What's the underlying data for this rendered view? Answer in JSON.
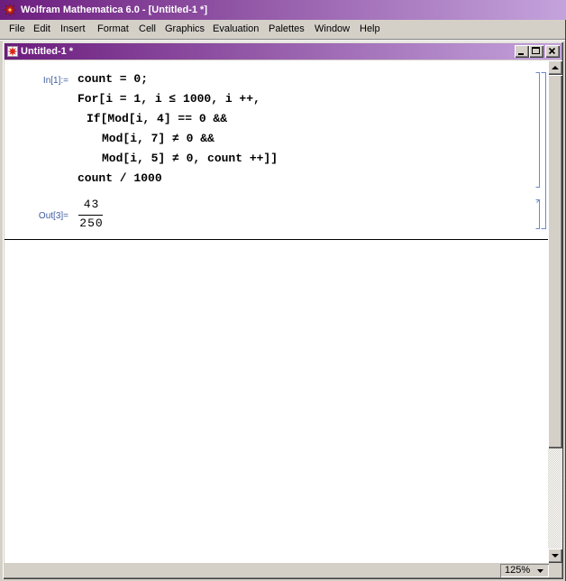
{
  "app": {
    "title": "Wolfram Mathematica 6.0 - [Untitled-1 *]"
  },
  "menu": {
    "items": [
      {
        "label": "File"
      },
      {
        "label": "Edit"
      },
      {
        "label": "Insert"
      },
      {
        "label": "Format"
      },
      {
        "label": "Cell"
      },
      {
        "label": "Graphics"
      },
      {
        "label": "Evaluation"
      },
      {
        "label": "Palettes"
      },
      {
        "label": "Window"
      },
      {
        "label": "Help"
      }
    ]
  },
  "notebook": {
    "title": "Untitled-1 *",
    "zoom": "125%",
    "input_cell": {
      "label": "In[1]:=",
      "lines": [
        "count = 0;",
        "For[i = 1, i ≤ 1000, i ++,",
        "If[Mod[i, 4] == 0 &&",
        "Mod[i, 7] ≠ 0 &&",
        "Mod[i, 5] ≠ 0, count ++]]",
        "count / 1000"
      ]
    },
    "output_cell": {
      "label": "Out[3]=",
      "numerator": "43",
      "denominator": "250"
    }
  },
  "icons": {
    "app": "mathematica-spikey-icon",
    "notebook": "notebook-icon",
    "minimize": "minimize-icon",
    "maximize": "maximize-icon",
    "close": "close-icon",
    "scroll_up": "arrow-up-icon",
    "scroll_down": "arrow-down-icon",
    "zoom_menu": "chevron-down-icon"
  },
  "colors": {
    "title_bar_start": "#6c1d7e",
    "title_bar_end": "#c4a3dc",
    "window_face": "#d4d0c8",
    "label_color": "#3d5b9e",
    "bracket_color": "#6a89cb"
  }
}
